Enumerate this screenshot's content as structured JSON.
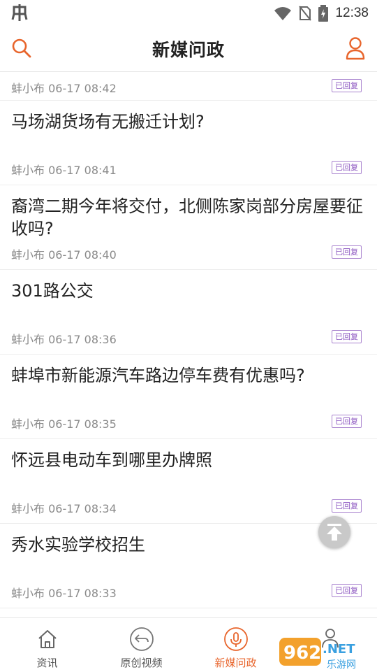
{
  "status_bar": {
    "time": "12:38"
  },
  "header": {
    "title": "新媒问政"
  },
  "list": {
    "top_partial": {
      "meta": "蚌小布 06-17 08:42",
      "badge": "已回复"
    },
    "items": [
      {
        "question": "马场湖货场有无搬迁计划?",
        "meta": "蚌小布 06-17 08:41",
        "badge": "已回复"
      },
      {
        "question": "裔湾二期今年将交付，北侧陈家岗部分房屋要征收吗?",
        "meta": "蚌小布 06-17 08:40",
        "badge": "已回复"
      },
      {
        "question": "301路公交",
        "meta": "蚌小布 06-17 08:36",
        "badge": "已回复"
      },
      {
        "question": "蚌埠市新能源汽车路边停车费有优惠吗?",
        "meta": "蚌小布 06-17 08:35",
        "badge": "已回复"
      },
      {
        "question": "怀远县电动车到哪里办牌照",
        "meta": "蚌小布 06-17 08:34",
        "badge": "已回复"
      },
      {
        "question": "秀水实验学校招生",
        "meta": "蚌小布 06-17 08:33",
        "badge": "已回复"
      }
    ]
  },
  "bottom_nav": {
    "tabs": [
      {
        "label": "资讯",
        "icon": "home-icon"
      },
      {
        "label": "原创视频",
        "icon": "video-icon"
      },
      {
        "label": "新媒问政",
        "icon": "microphone-icon",
        "active": true
      },
      {
        "label": "",
        "icon": "profile-icon"
      }
    ]
  },
  "watermark": {
    "text": "962.NET",
    "subtext": "乐游网"
  },
  "colors": {
    "accent": "#e8652c",
    "badge": "#8b55c0"
  }
}
